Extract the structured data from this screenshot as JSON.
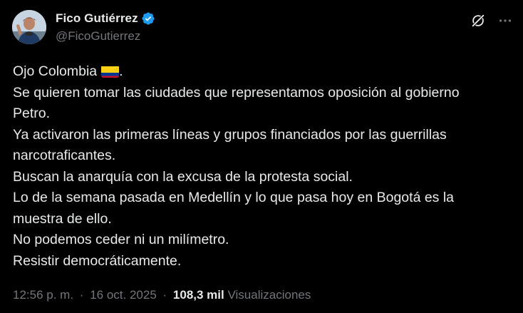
{
  "author": {
    "display_name": "Fico Gutiérrez",
    "handle": "@FicoGutierrez",
    "verified": true,
    "verified_color": "#1d9bf0"
  },
  "icons": {
    "avatar": "profile-photo",
    "verified": "verified-badge-icon",
    "grok": "grok-icon",
    "more": "more-options-icon",
    "flag": "colombia-flag-emoji"
  },
  "tweet": {
    "lines": [
      "Ojo Colombia",
      ".",
      "Se quieren tomar las ciudades que representamos oposición al gobierno",
      "Petro.",
      "Ya activaron las primeras líneas y grupos financiados por las guerrillas",
      "narcotraficantes.",
      "Buscan la anarquía con la excusa de la protesta social.",
      "Lo de la semana pasada en Medellín y lo que pasa hoy en Bogotá es la",
      "muestra de ello.",
      "No podemos ceder ni un milímetro.",
      "Resistir democráticamente."
    ]
  },
  "meta": {
    "time": "12:56 p. m.",
    "separator": "·",
    "date": "16 oct. 2025",
    "views_count": "108,3 mil",
    "views_label": "Visualizaciones"
  },
  "colors": {
    "background": "#000000",
    "text_primary": "#e7e9ea",
    "text_secondary": "#71767b",
    "accent": "#1d9bf0"
  }
}
